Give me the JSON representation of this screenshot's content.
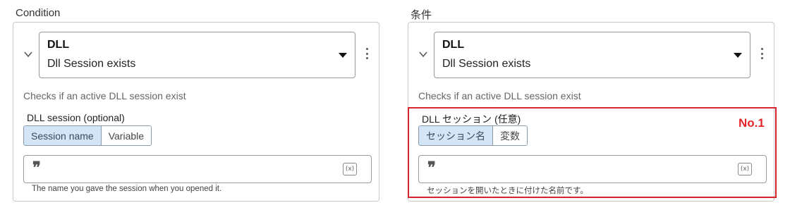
{
  "left_panel": {
    "heading": "Condition",
    "select_title": "DLL",
    "select_value": "Dll Session exists",
    "description": "Checks if an active DLL session exist",
    "field_label": "DLL session (optional)",
    "toggle": [
      "Session name",
      "Variable"
    ],
    "input_icon": "(x)",
    "help_text": "The name you gave the session when you opened it."
  },
  "right_panel": {
    "heading": "条件",
    "select_title": "DLL",
    "select_value": "Dll Session exists",
    "description": "Checks if an active DLL session exist",
    "field_label": "DLL セッション (任意)",
    "toggle": [
      "セッション名",
      "変数"
    ],
    "input_icon": "(x)",
    "help_text": "セッションを開いたときに付けた名前です。"
  },
  "annotation": {
    "label": "No.1",
    "color": "#e6252b"
  },
  "colors": {
    "toggle_active_bg": "#d3e5f7",
    "highlight_border": "#d6242c"
  }
}
